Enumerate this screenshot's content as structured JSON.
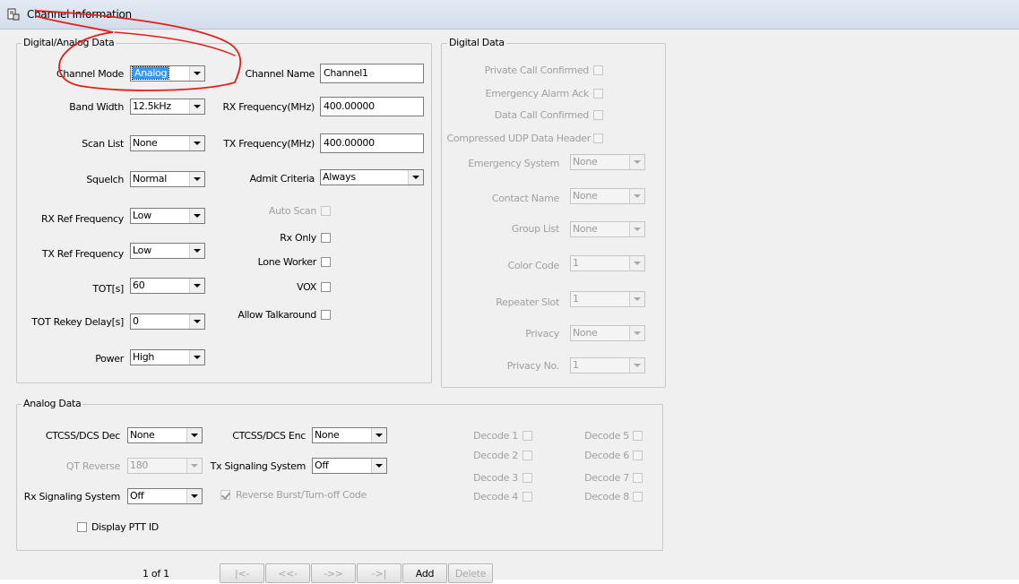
{
  "window": {
    "title": "Channel Information",
    "icon": "channel-document-icon"
  },
  "digital_analog": {
    "legend": "Digital/Analog Data",
    "channel_mode": {
      "label": "Channel Mode",
      "value": "Analog"
    },
    "band_width": {
      "label": "Band Width",
      "value": "12.5kHz"
    },
    "scan_list": {
      "label": "Scan List",
      "value": "None"
    },
    "squelch": {
      "label": "Squelch",
      "value": "Normal"
    },
    "rx_ref": {
      "label": "RX Ref Frequency",
      "value": "Low"
    },
    "tx_ref": {
      "label": "TX Ref Frequency",
      "value": "Low"
    },
    "tot": {
      "label": "TOT[s]",
      "value": "60"
    },
    "tot_rekey": {
      "label": "TOT Rekey Delay[s]",
      "value": "0"
    },
    "power": {
      "label": "Power",
      "value": "High"
    },
    "channel_name": {
      "label": "Channel Name",
      "value": "Channel1"
    },
    "rx_freq": {
      "label": "RX Frequency(MHz)",
      "value": "400.00000"
    },
    "tx_freq": {
      "label": "TX Frequency(MHz)",
      "value": "400.00000"
    },
    "admit_criteria": {
      "label": "Admit Criteria",
      "value": "Always"
    },
    "auto_scan": {
      "label": "Auto Scan",
      "checked": false
    },
    "rx_only": {
      "label": "Rx Only",
      "checked": false
    },
    "lone_worker": {
      "label": "Lone Worker",
      "checked": false
    },
    "vox": {
      "label": "VOX",
      "checked": false
    },
    "allow_talkaround": {
      "label": "Allow Talkaround",
      "checked": false
    }
  },
  "digital": {
    "legend": "Digital Data",
    "private_call": {
      "label": "Private Call Confirmed"
    },
    "emergency_ack": {
      "label": "Emergency Alarm Ack"
    },
    "data_call": {
      "label": "Data Call Confirmed"
    },
    "compressed_udp": {
      "label": "Compressed UDP Data Header"
    },
    "emergency_system": {
      "label": "Emergency System",
      "value": "None"
    },
    "contact_name": {
      "label": "Contact Name",
      "value": "None"
    },
    "group_list": {
      "label": "Group List",
      "value": "None"
    },
    "color_code": {
      "label": "Color Code",
      "value": "1"
    },
    "repeater_slot": {
      "label": "Repeater Slot",
      "value": "1"
    },
    "privacy": {
      "label": "Privacy",
      "value": "None"
    },
    "privacy_no": {
      "label": "Privacy No.",
      "value": "1"
    }
  },
  "analog": {
    "legend": "Analog Data",
    "ctcss_dec": {
      "label": "CTCSS/DCS Dec",
      "value": "None"
    },
    "ctcss_enc": {
      "label": "CTCSS/DCS Enc",
      "value": "None"
    },
    "qt_reverse": {
      "label": "QT Reverse",
      "value": "180"
    },
    "tx_signaling": {
      "label": "Tx Signaling System",
      "value": "Off"
    },
    "rx_signaling": {
      "label": "Rx Signaling System",
      "value": "Off"
    },
    "reverse_burst": {
      "label": "Reverse Burst/Turn-off Code",
      "checked": true
    },
    "display_ptt": {
      "label": "Display PTT ID",
      "checked": false
    },
    "decodes": [
      "Decode 1",
      "Decode 2",
      "Decode 3",
      "Decode 4",
      "Decode 5",
      "Decode 6",
      "Decode 7",
      "Decode 8"
    ]
  },
  "footer": {
    "page_indicator": "1 of 1",
    "first": "|<-",
    "prev": "<<-",
    "next": "->>",
    "last": "->|",
    "add": "Add",
    "delete": "Delete"
  },
  "annotation": {
    "color": "#e0201c"
  }
}
